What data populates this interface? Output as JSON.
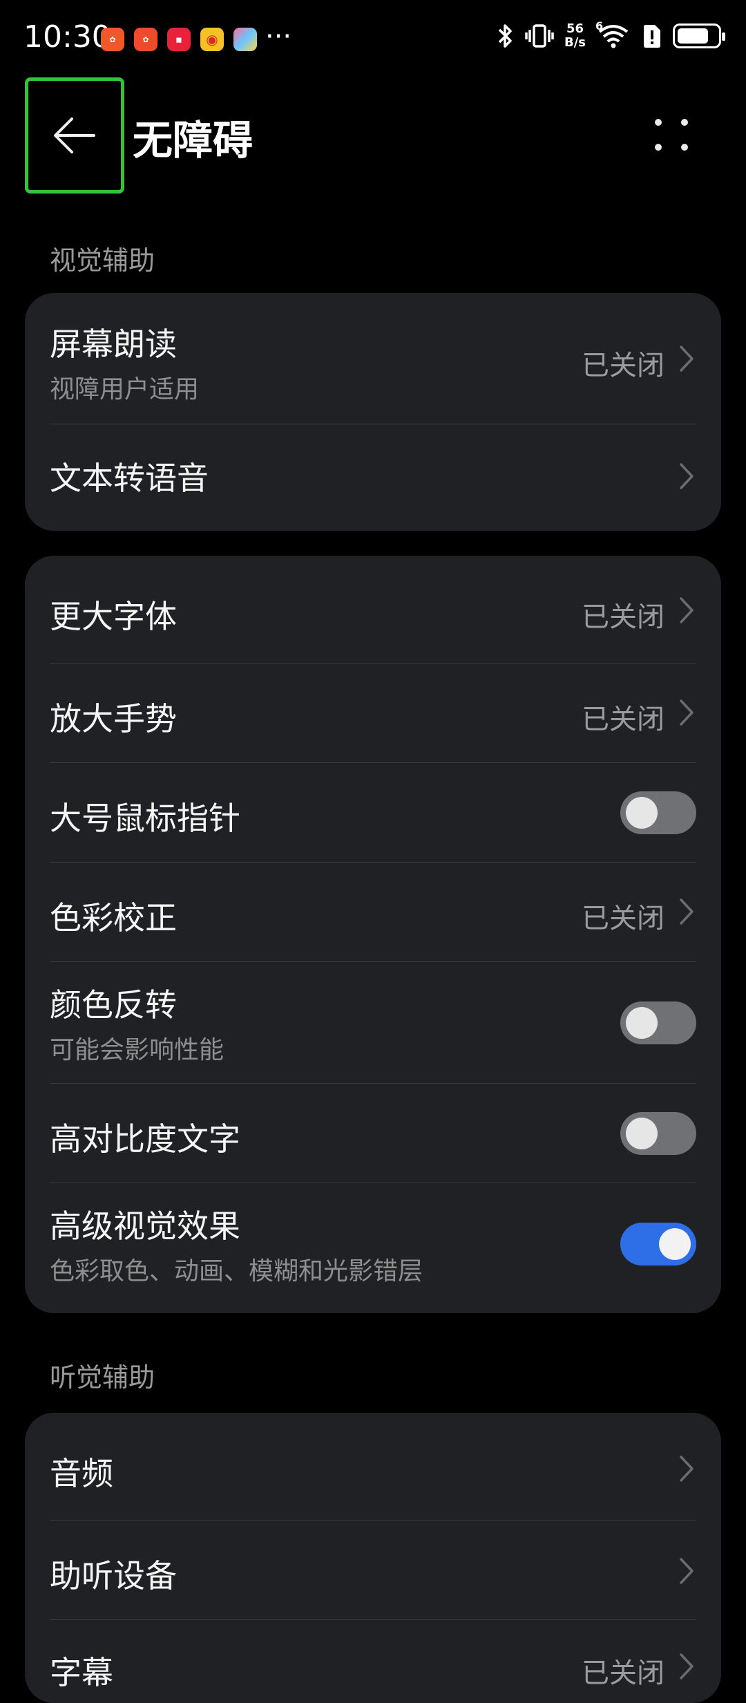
{
  "status_bar": {
    "time": "10:30",
    "net_speed_value": "56",
    "net_speed_unit": "B/s",
    "signal_label": "6",
    "more_label": "···",
    "notification_icons": [
      "app-orange-icon",
      "app-red-orange-icon",
      "app-red-icon",
      "weibo-icon",
      "app-colorful-icon"
    ]
  },
  "header": {
    "title": "无障碍"
  },
  "sections": {
    "visual": {
      "label": "视觉辅助",
      "card1": {
        "screen_reader": {
          "title": "屏幕朗读",
          "subtitle": "视障用户适用",
          "value": "已关闭"
        },
        "tts": {
          "title": "文本转语音"
        }
      },
      "card2": {
        "larger_font": {
          "title": "更大字体",
          "value": "已关闭"
        },
        "magnify": {
          "title": "放大手势",
          "value": "已关闭"
        },
        "large_pointer": {
          "title": "大号鼠标指针",
          "toggle_on": false
        },
        "color_correction": {
          "title": "色彩校正",
          "value": "已关闭"
        },
        "color_inversion": {
          "title": "颜色反转",
          "subtitle": "可能会影响性能",
          "toggle_on": false
        },
        "high_contrast": {
          "title": "高对比度文字",
          "toggle_on": false
        },
        "advanced_visual": {
          "title": "高级视觉效果",
          "subtitle": "色彩取色、动画、模糊和光影错层",
          "toggle_on": true
        }
      }
    },
    "hearing": {
      "label": "听觉辅助",
      "audio": {
        "title": "音频"
      },
      "hearing_aid": {
        "title": "助听设备"
      },
      "subtitles": {
        "title": "字幕",
        "value": "已关闭"
      }
    }
  },
  "colors": {
    "background": "#000000",
    "card": "#202124",
    "accent_toggle": "#2e6fe8",
    "focus_outline": "#33c43a"
  }
}
